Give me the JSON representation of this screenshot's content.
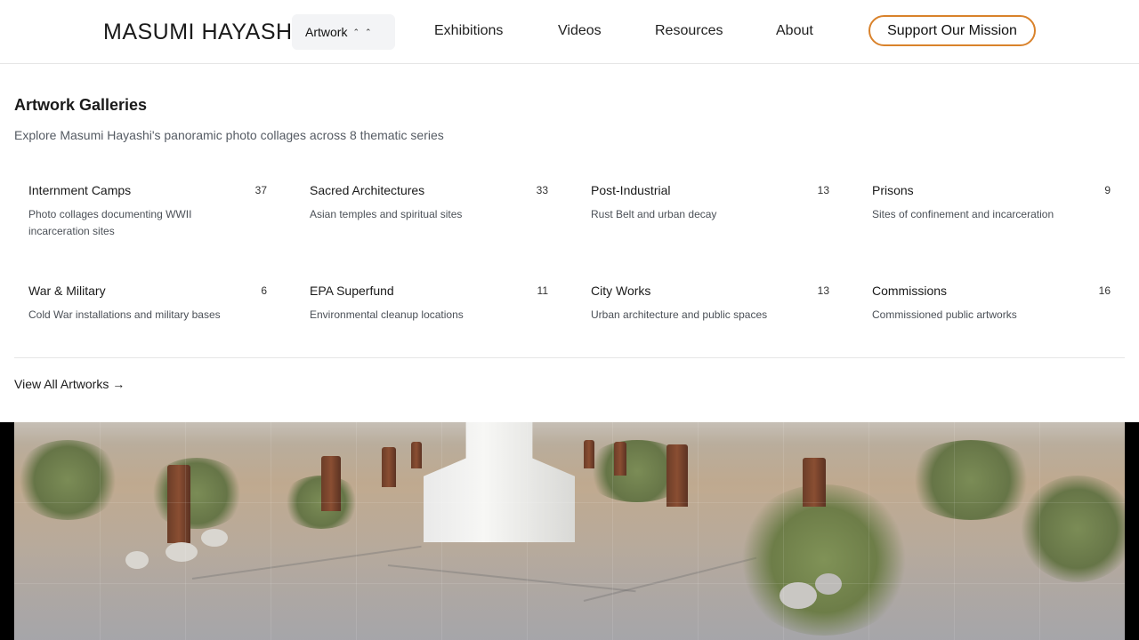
{
  "header": {
    "logo": "MASUMI HAYASHI",
    "nav": {
      "artwork": "Artwork",
      "exhibitions": "Exhibitions",
      "videos": "Videos",
      "resources": "Resources",
      "about": "About"
    },
    "support_label": "Support Our Mission"
  },
  "panel": {
    "title": "Artwork Galleries",
    "subtitle": "Explore Masumi Hayashi's panoramic photo collages across 8 thematic series",
    "galleries": [
      {
        "name": "Internment Camps",
        "count": "37",
        "description": "Photo collages documenting WWII incarceration sites"
      },
      {
        "name": "Sacred Architectures",
        "count": "33",
        "description": "Asian temples and spiritual sites"
      },
      {
        "name": "Post-Industrial",
        "count": "13",
        "description": "Rust Belt and urban decay"
      },
      {
        "name": "Prisons",
        "count": "9",
        "description": "Sites of confinement and incarceration"
      },
      {
        "name": "War & Military",
        "count": "6",
        "description": "Cold War installations and military bases"
      },
      {
        "name": "EPA Superfund",
        "count": "11",
        "description": "Environmental cleanup locations"
      },
      {
        "name": "City Works",
        "count": "13",
        "description": "Urban architecture and public spaces"
      },
      {
        "name": "Commissions",
        "count": "16",
        "description": "Commissioned public artworks"
      }
    ],
    "view_all": "View All Artworks →"
  },
  "icons": {
    "artwork_chevrons": "chevron-up-icon"
  }
}
